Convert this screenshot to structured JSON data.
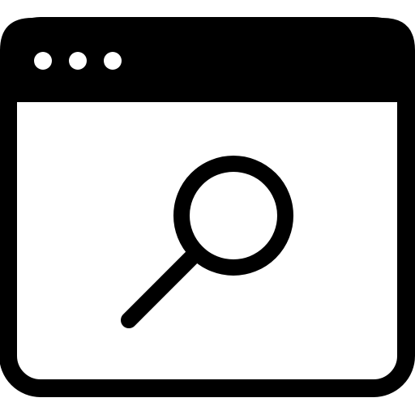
{
  "icon": {
    "name": "browser-window-search-icon",
    "stroke_color": "#000000",
    "fill_color": "#ffffff",
    "window_control_dots": 3
  }
}
